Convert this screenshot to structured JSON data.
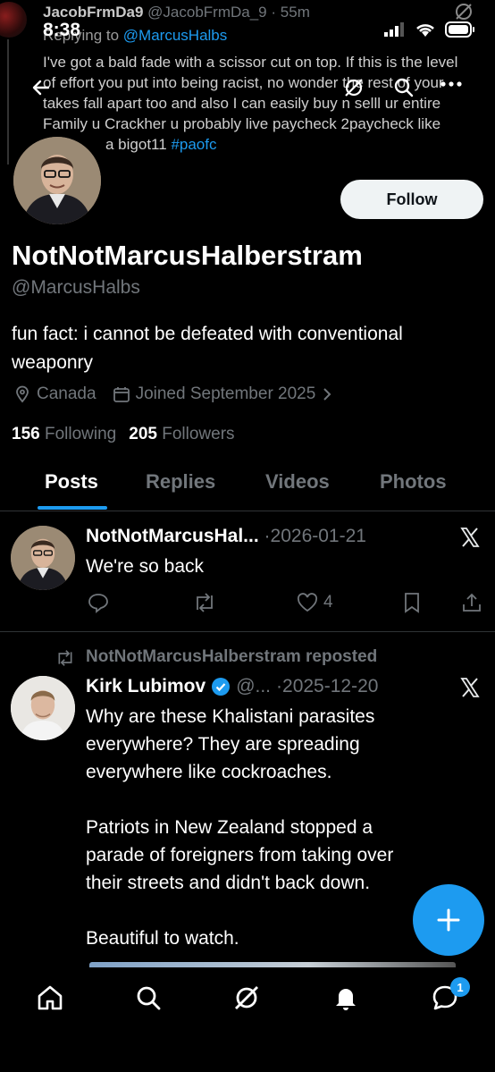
{
  "status_bar": {
    "time": "8:38"
  },
  "overlay_tweet": {
    "name": "JacobFrmDa9",
    "handle": "@JacobFrmDa_9",
    "dot": "·",
    "age": "55m",
    "replying_prefix": "Replying to",
    "replying_to": "@MarcusHalbs",
    "body_lines": [
      "I've got a bald fade with a scissor cut on top. If this is the level",
      "of effort you put into being racist, no wonder the rest of your",
      "takes fall apart too and also I can easily buy n selll ur entire",
      "Family u Crackher u probably live paycheck 2paycheck like"
    ],
    "body_tail": "a bigot11",
    "hashtag": "#paofc"
  },
  "profile": {
    "follow_label": "Follow",
    "display_name": "NotNotMarcusHalberstram",
    "handle": "@MarcusHalbs",
    "bio": "fun fact: i cannot be defeated with conventional weaponry",
    "location": "Canada",
    "joined": "Joined September 2025",
    "following_count": "156",
    "following_label": "Following",
    "followers_count": "205",
    "followers_label": "Followers"
  },
  "tabs": [
    {
      "label": "Posts"
    },
    {
      "label": "Replies"
    },
    {
      "label": "Videos"
    },
    {
      "label": "Photos"
    }
  ],
  "posts": [
    {
      "name": "NotNotMarcusHal...",
      "dot": "·",
      "date": "2026-01-21",
      "text": "We're so back",
      "like_count": "4"
    },
    {
      "repost_label": "NotNotMarcusHalberstram reposted",
      "name": "Kirk Lubimov",
      "handle": "@...",
      "dot": "·",
      "date": "2025-12-20",
      "text_lines": [
        "Why are these Khalistani parasites",
        "everywhere? They are spreading",
        "everywhere like cockroaches."
      ],
      "text_lines_2": [
        "Patriots in New Zealand stopped a",
        "parade of foreigners from taking over",
        "their streets and didn't back down."
      ],
      "text_3": "Beautiful to watch."
    }
  ],
  "bottom_nav": {
    "messages_badge": "1"
  },
  "colors": {
    "accent": "#1d9bf0",
    "background": "#000000",
    "muted": "#71767b"
  }
}
